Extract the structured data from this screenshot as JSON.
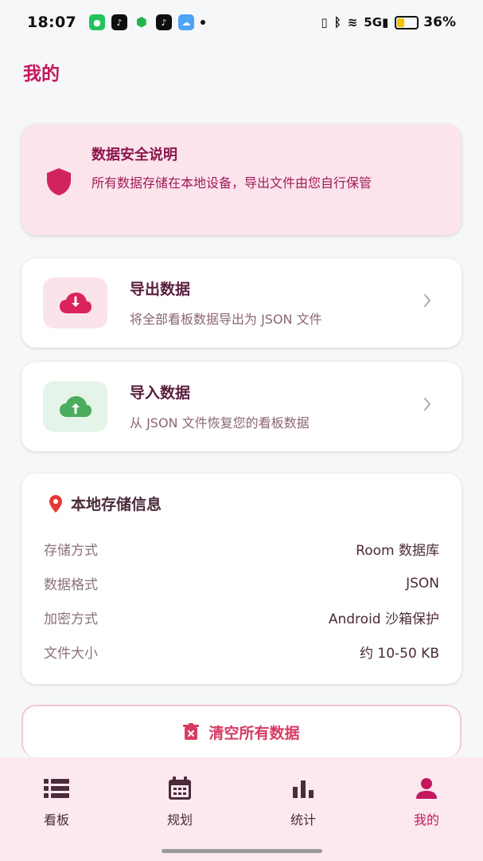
{
  "status_bar": {
    "time": "18:07",
    "battery": "36%",
    "battery_level": 0.36,
    "network": "5G"
  },
  "page": {
    "title": "我的"
  },
  "security_notice": {
    "title": "数据安全说明",
    "description": "所有数据存储在本地设备，导出文件由您自行保管"
  },
  "actions": [
    {
      "title": "导出数据",
      "description": "将全部看板数据导出为 JSON 文件"
    },
    {
      "title": "导入数据",
      "description": "从 JSON 文件恢复您的看板数据"
    }
  ],
  "storage": {
    "title": "本地存储信息",
    "rows": [
      {
        "label": "存储方式",
        "value": "Room 数据库"
      },
      {
        "label": "数据格式",
        "value": "JSON"
      },
      {
        "label": "加密方式",
        "value": "Android 沙箱保护"
      },
      {
        "label": "文件大小",
        "value": "约 10-50 KB"
      }
    ]
  },
  "clear_button": {
    "label": "清空所有数据"
  },
  "bottom_nav": [
    {
      "label": "看板",
      "active": false
    },
    {
      "label": "规划",
      "active": false
    },
    {
      "label": "统计",
      "active": false
    },
    {
      "label": "我的",
      "active": true
    }
  ],
  "colors": {
    "brand": "#c4185d",
    "danger": "#d73b63",
    "export_bg": "#fbe3ea",
    "import_bg": "#e4f4e8",
    "nav_bg": "#fce8ef"
  }
}
